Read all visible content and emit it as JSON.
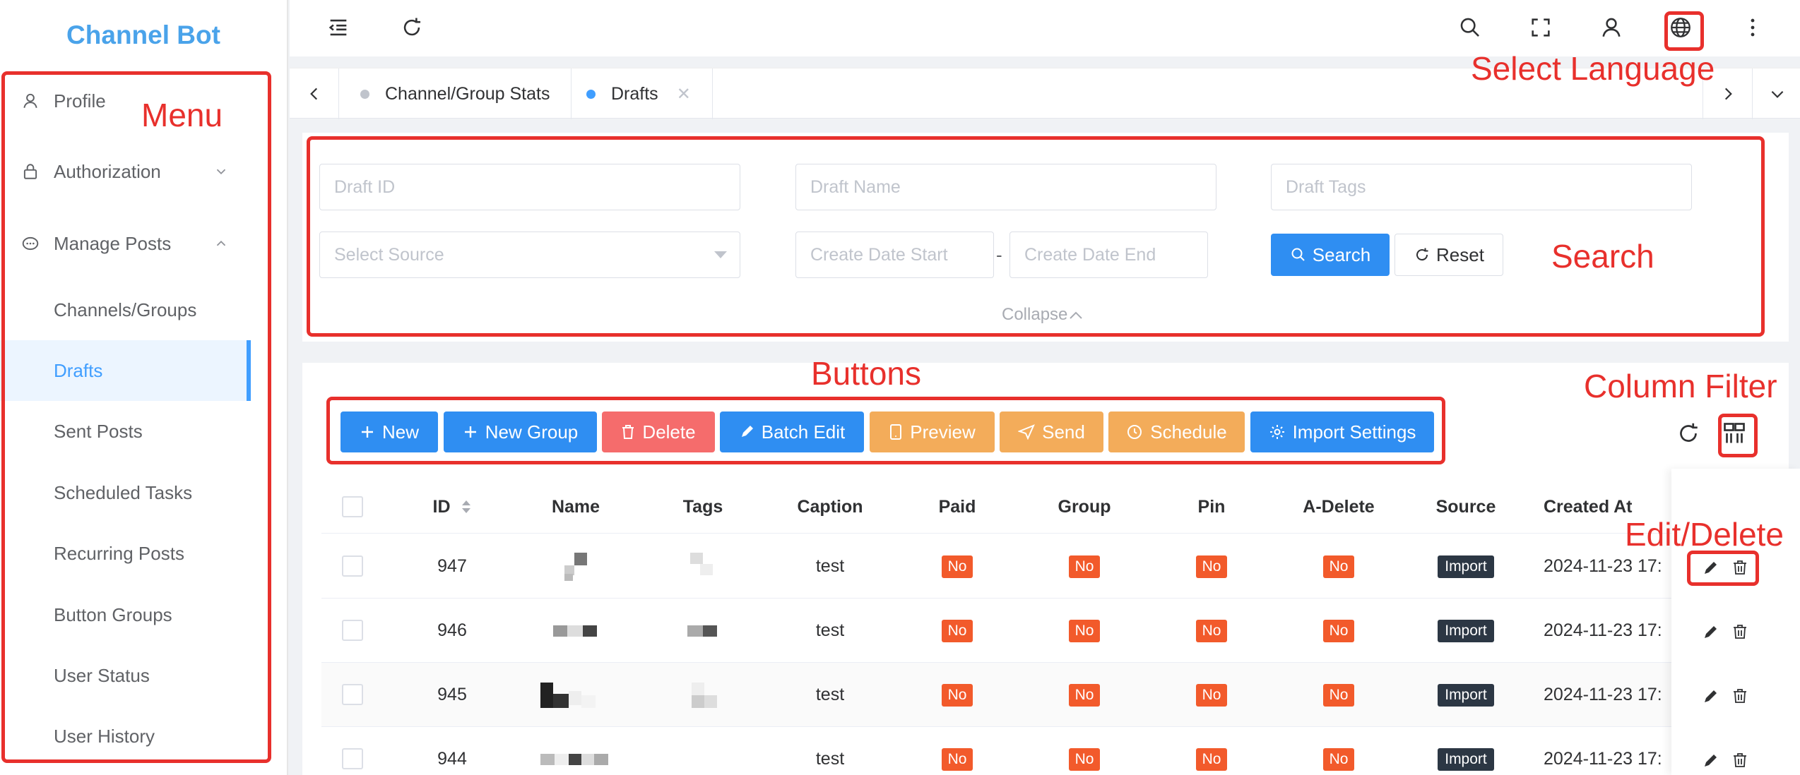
{
  "app": {
    "title": "Channel Bot"
  },
  "sidebar": {
    "items": [
      {
        "label": "Profile"
      },
      {
        "label": "Authorization"
      },
      {
        "label": "Manage Posts"
      },
      {
        "label": "Channels/Groups"
      },
      {
        "label": "Drafts"
      },
      {
        "label": "Sent Posts"
      },
      {
        "label": "Scheduled Tasks"
      },
      {
        "label": "Recurring Posts"
      },
      {
        "label": "Button Groups"
      },
      {
        "label": "User Status"
      },
      {
        "label": "User History"
      }
    ]
  },
  "tabs": [
    {
      "label": "Channel/Group Stats"
    },
    {
      "label": "Drafts",
      "close": "✕"
    }
  ],
  "search": {
    "draft_id_placeholder": "Draft ID",
    "draft_name_placeholder": "Draft Name",
    "draft_tags_placeholder": "Draft Tags",
    "source_placeholder": "Select Source",
    "date_start_placeholder": "Create Date Start",
    "date_separator": "-",
    "date_end_placeholder": "Create Date End",
    "search_label": "Search",
    "reset_label": "Reset",
    "collapse_label": "Collapse"
  },
  "toolbar": {
    "new_label": "New",
    "new_group_label": "New Group",
    "delete_label": "Delete",
    "batch_edit_label": "Batch Edit",
    "preview_label": "Preview",
    "send_label": "Send",
    "schedule_label": "Schedule",
    "import_settings_label": "Import Settings"
  },
  "table": {
    "headers": [
      "ID",
      "Name",
      "Tags",
      "Caption",
      "Paid",
      "Group",
      "Pin",
      "A-Delete",
      "Source",
      "Created At"
    ],
    "rows": [
      {
        "id": "947",
        "caption": "test",
        "paid": "No",
        "group": "No",
        "pin": "No",
        "adelete": "No",
        "source": "Import",
        "created": "2024-11-23 17:"
      },
      {
        "id": "946",
        "caption": "test",
        "paid": "No",
        "group": "No",
        "pin": "No",
        "adelete": "No",
        "source": "Import",
        "created": "2024-11-23 17:"
      },
      {
        "id": "945",
        "caption": "test",
        "paid": "No",
        "group": "No",
        "pin": "No",
        "adelete": "No",
        "source": "Import",
        "created": "2024-11-23 17:"
      },
      {
        "id": "944",
        "caption": "test",
        "paid": "No",
        "group": "No",
        "pin": "No",
        "adelete": "No",
        "source": "Import",
        "created": "2024-11-23 17:"
      }
    ]
  },
  "annotations": {
    "menu": "Menu",
    "select_language": "Select Language",
    "search": "Search",
    "buttons": "Buttons",
    "column_filter": "Column Filter",
    "edit_delete": "Edit/Delete"
  },
  "colors": {
    "primary": "#2f8ef2",
    "danger": "#f56c6c",
    "warning": "#f3ac5a",
    "tag_no": "#f25a2b",
    "tag_source": "#2c3744",
    "annotation": "#e8302c",
    "brand": "#4aa3ea"
  }
}
